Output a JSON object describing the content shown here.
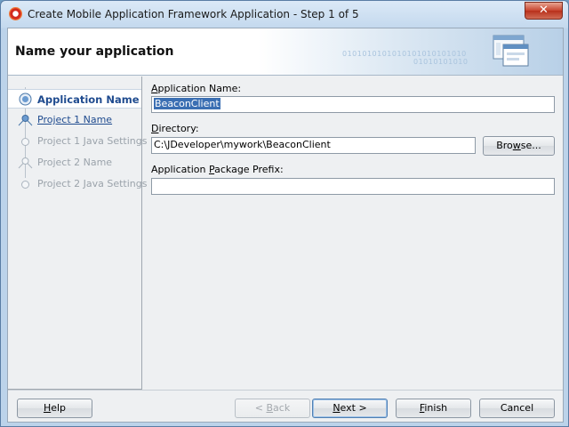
{
  "window": {
    "title": "Create Mobile Application Framework Application - Step 1 of 5",
    "close_glyph": "✕"
  },
  "banner": {
    "title": "Name your application",
    "binary_text_1": "0101010101010101010101010",
    "binary_text_2": "01010101010"
  },
  "nav": {
    "items": [
      {
        "label": "Application Name",
        "state": "active"
      },
      {
        "label": "Project 1 Name",
        "state": "link"
      },
      {
        "label": "Project 1 Java Settings",
        "state": "disabled"
      },
      {
        "label": "Project 2 Name",
        "state": "disabled"
      },
      {
        "label": "Project 2 Java Settings",
        "state": "disabled"
      }
    ]
  },
  "form": {
    "app_name_label_mnemonic": "A",
    "app_name_label_rest": "pplication Name:",
    "app_name_value": "BeaconClient",
    "directory_label_mnemonic": "D",
    "directory_label_rest": "irectory:",
    "directory_value": "C:\\JDeveloper\\mywork\\BeaconClient",
    "browse_label_pre": "Bro",
    "browse_label_mnemonic": "w",
    "browse_label_post": "se...",
    "package_prefix_label_pre": "Application ",
    "package_prefix_label_mnemonic": "P",
    "package_prefix_label_post": "ackage Prefix:",
    "package_prefix_value": ""
  },
  "buttons": {
    "help_mnemonic": "H",
    "help_rest": "elp",
    "back_pre": "< ",
    "back_mnemonic": "B",
    "back_rest": "ack",
    "next_mnemonic": "N",
    "next_rest": "ext >",
    "finish_mnemonic": "F",
    "finish_rest": "inish",
    "cancel": "Cancel"
  },
  "colors": {
    "accent": "#1f4b8f",
    "selection": "#3b6fb3",
    "close_button": "#c7432d"
  }
}
